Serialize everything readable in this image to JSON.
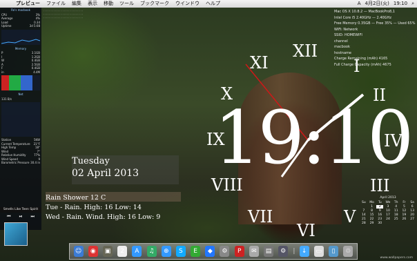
{
  "menubar": {
    "apple_icon": "",
    "app": "プレビュー",
    "items": [
      "ファイル",
      "編集",
      "表示",
      "移動",
      "ツール",
      "ブックマーク",
      "ウインドウ",
      "ヘルプ"
    ],
    "status": [
      "A",
      "4月2日(火)",
      "19:10"
    ]
  },
  "sidebar": {
    "title": "Ro's macbook",
    "cpu_rows": [
      {
        "label": "CPU",
        "value": "3%"
      },
      {
        "label": "Average",
        "value": "4%"
      },
      {
        "label": "Load",
        "value": "0.34"
      },
      {
        "label": "Uptime",
        "value": "3d 5:08"
      }
    ],
    "memory_title": "Memory",
    "memory_rows": [
      {
        "label": "P",
        "value": "3.1GB"
      },
      {
        "label": "I",
        "value": "1.2GB"
      },
      {
        "label": "W",
        "value": "0.4GB"
      },
      {
        "label": "A",
        "value": "2.5GB"
      },
      {
        "label": "F",
        "value": "0.4GB"
      },
      {
        "label": "in",
        "value": "4.4M"
      }
    ],
    "net_title": "Net",
    "net_rows": [
      {
        "label": "131 B/s",
        "value": ""
      }
    ],
    "sensor_rows": [
      {
        "label": "Station",
        "value": "5KW"
      },
      {
        "label": "Current Temperature",
        "value": "21°F"
      },
      {
        "label": "High Temp",
        "value": "18°"
      },
      {
        "label": "Wind",
        "value": "7°"
      },
      {
        "label": "Relative Humidity",
        "value": "77%"
      },
      {
        "label": "Wind Speed",
        "value": "9"
      },
      {
        "label": "Barometric Pressure",
        "value": "30.4 in"
      }
    ],
    "song": "Smells Like Teen Spirit",
    "controls": [
      "⏮",
      "⏯",
      "⏭"
    ]
  },
  "stats": [
    "Mac OS X 10.8.2 — MacBookPro8,1",
    "Intel Core i5 2.40GHz — 2.40GHz",
    "",
    "Free Memory 0.35GB — Free 35% — Used 65%",
    "",
    "WiFi: Network",
    "SSID: HOMEWIFI",
    "channel",
    "macbook",
    "hostname",
    "Charge Remaining (mAh) 4165",
    "Full Charge Capacity (mAh) 4675"
  ],
  "date": {
    "day": "Tuesday",
    "full": "02 April 2013"
  },
  "weather": {
    "now": "Rain Shower 12 C",
    "tue": "Tue - Rain. High: 16 Low: 14",
    "wed": "Wed - Rain. Wind. High: 16 Low: 9"
  },
  "clock": {
    "time": "19:10",
    "numerals": [
      "XII",
      "I",
      "II",
      "III",
      "IV",
      "V",
      "VI",
      "VII",
      "VIII",
      "IX",
      "X",
      "XI"
    ]
  },
  "calendar": {
    "title": "April 2013",
    "headers": [
      "Su",
      "Mo",
      "Tu",
      "We",
      "Th",
      "Fr",
      "Sa"
    ],
    "days": [
      "",
      "1",
      "2",
      "3",
      "4",
      "5",
      "6",
      "7",
      "8",
      "9",
      "10",
      "11",
      "12",
      "13",
      "14",
      "15",
      "16",
      "17",
      "18",
      "19",
      "20",
      "21",
      "22",
      "23",
      "24",
      "25",
      "26",
      "27",
      "28",
      "29",
      "30",
      "",
      "",
      "",
      ""
    ]
  },
  "dock": {
    "icons": [
      {
        "name": "finder-icon",
        "glyph": "☺",
        "color": "#3b7bd4"
      },
      {
        "name": "chrome-icon",
        "glyph": "◉",
        "color": "#d33"
      },
      {
        "name": "photo-icon",
        "glyph": "▣",
        "color": "#665"
      },
      {
        "name": "calendar-icon",
        "glyph": "2",
        "color": "#eee"
      },
      {
        "name": "appstore-icon",
        "glyph": "A",
        "color": "#39f"
      },
      {
        "name": "itunes-icon",
        "glyph": "♫",
        "color": "#3a6"
      },
      {
        "name": "safari-icon",
        "glyph": "⊕",
        "color": "#39f"
      },
      {
        "name": "skype-icon",
        "glyph": "S",
        "color": "#1af"
      },
      {
        "name": "evernote-icon",
        "glyph": "E",
        "color": "#3a3"
      },
      {
        "name": "dropbox-icon",
        "glyph": "◆",
        "color": "#27f"
      },
      {
        "name": "utility-icon",
        "glyph": "⚙",
        "color": "#888"
      },
      {
        "name": "pdf-icon",
        "glyph": "P",
        "color": "#c22"
      },
      {
        "name": "mail-icon",
        "glyph": "✉",
        "color": "#aaa"
      },
      {
        "name": "preview-icon",
        "glyph": "▤",
        "color": "#777"
      },
      {
        "name": "sysprefs-icon",
        "glyph": "⚙",
        "color": "#556"
      },
      {
        "name": "separator",
        "glyph": "|",
        "color": "transparent"
      },
      {
        "name": "downloads-icon",
        "glyph": "↓",
        "color": "#4af"
      },
      {
        "name": "document-icon",
        "glyph": "▭",
        "color": "#ddd"
      },
      {
        "name": "folder-icon",
        "glyph": "▯",
        "color": "#59c"
      },
      {
        "name": "trash-icon",
        "glyph": "♲",
        "color": "#aaa"
      }
    ]
  },
  "watermark": "www.wallpapers.com"
}
